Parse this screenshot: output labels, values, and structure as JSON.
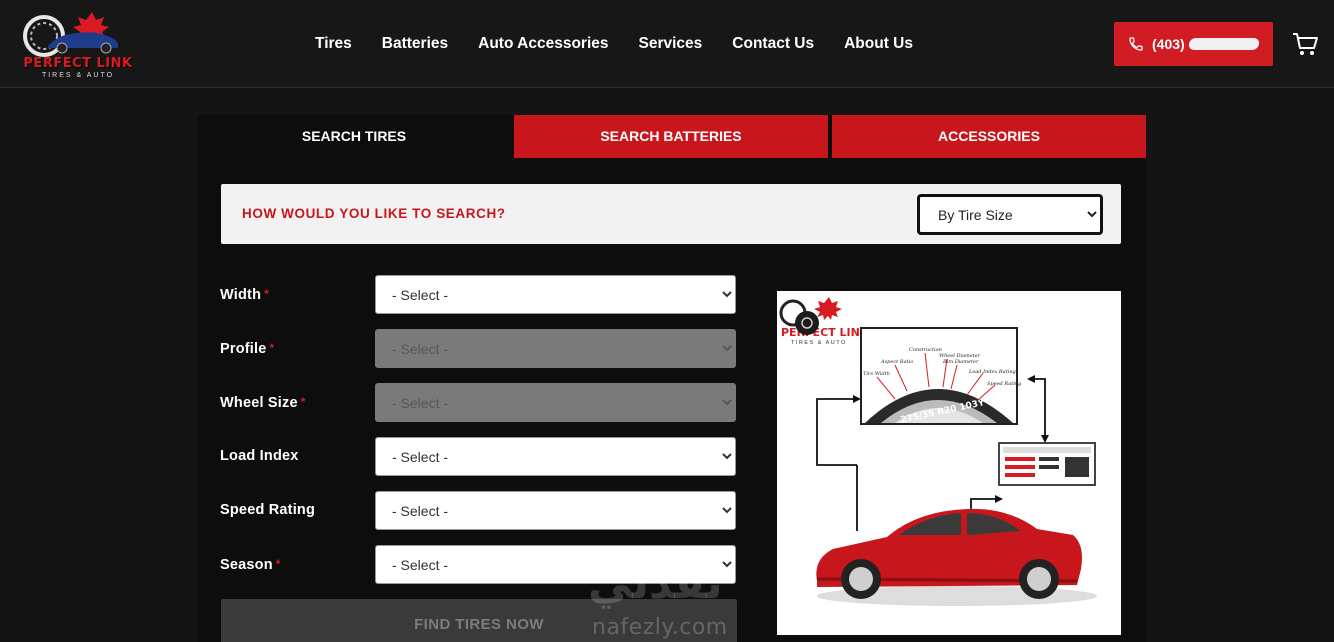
{
  "header": {
    "logo": {
      "title": "PERFECT LINK",
      "subtitle": "TIRES & AUTO"
    },
    "nav": [
      "Tires",
      "Batteries",
      "Auto Accessories",
      "Services",
      "Contact Us",
      "About Us"
    ],
    "phone_label": "(403)",
    "cart_icon": "cart-icon",
    "phone_icon": "phone-icon"
  },
  "tabs": [
    {
      "label": "SEARCH TIRES",
      "active": true
    },
    {
      "label": "SEARCH BATTERIES",
      "active": false
    },
    {
      "label": "ACCESSORIES",
      "active": false
    }
  ],
  "search": {
    "question": "HOW WOULD YOU LIKE TO SEARCH?",
    "mode_selected": "By Tire Size"
  },
  "form": {
    "fields": [
      {
        "label": "Width",
        "required": true,
        "value": "- Select -",
        "disabled": false
      },
      {
        "label": "Profile",
        "required": true,
        "value": "- Select -",
        "disabled": true
      },
      {
        "label": "Wheel Size",
        "required": true,
        "value": "- Select -",
        "disabled": true
      },
      {
        "label": "Load Index",
        "required": false,
        "value": "- Select -",
        "disabled": false
      },
      {
        "label": "Speed Rating",
        "required": false,
        "value": "- Select -",
        "disabled": false
      },
      {
        "label": "Season",
        "required": true,
        "value": "- Select -",
        "disabled": false
      }
    ],
    "required_mark": "*",
    "submit_label": "FIND TIRES NOW"
  },
  "diagram": {
    "logo_title": "PERFECT LINK",
    "logo_subtitle": "TIRES & AUTO",
    "tire_code": "275/35 R20 103Y",
    "callouts": [
      "Tire Width",
      "Aspect Ratio",
      "Construction",
      "Wheel Diameter",
      "Rim Diameter",
      "Load Index Rating",
      "Speed Rating"
    ]
  },
  "watermark": {
    "arabic": "نفذلي",
    "latin": "nafezly.com"
  },
  "colors": {
    "brand_red": "#c8161d",
    "background": "#141414",
    "panel": "#0d0d0d"
  }
}
